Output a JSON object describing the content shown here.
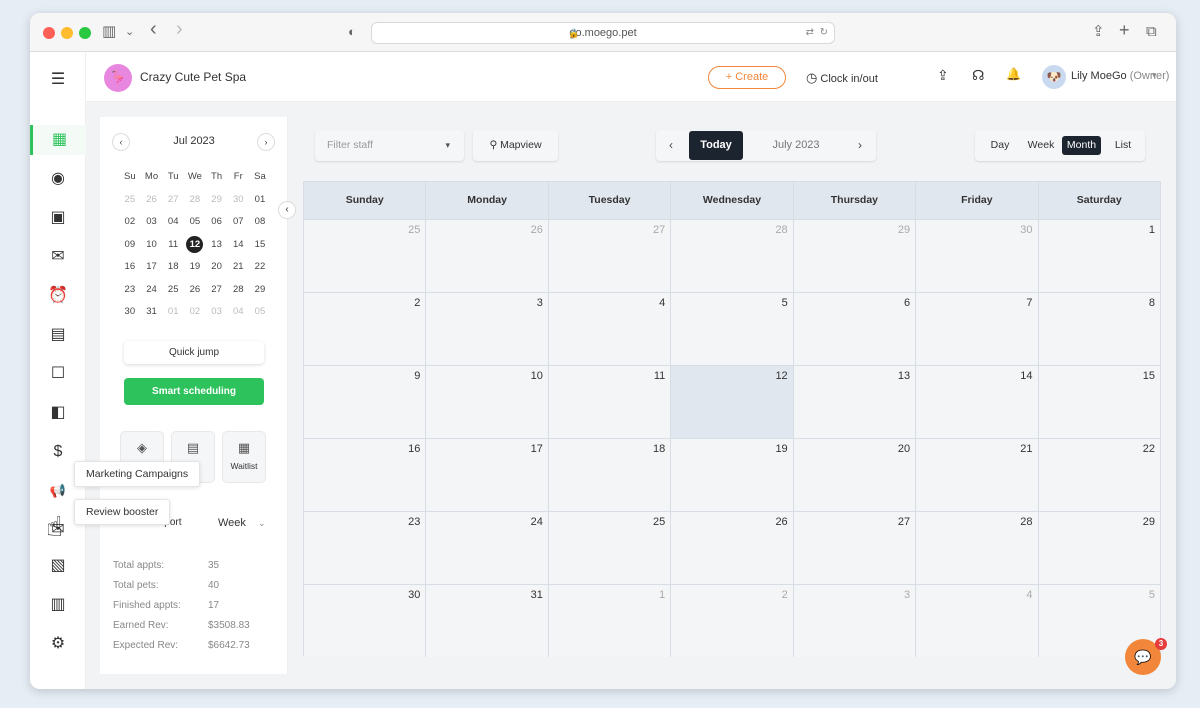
{
  "browser": {
    "url": "go.moego.pet",
    "icons": {
      "sidebar": "▥",
      "dropdown": "⌄",
      "back": "‹",
      "forward": "›",
      "shield": "◐",
      "lock": "🔒",
      "translate": "⇄",
      "reload": "↻",
      "share": "⇪",
      "newtab": "+",
      "tabs": "⧉"
    }
  },
  "leftnav": {
    "icons": [
      "☰",
      "▦",
      "◉",
      "▣",
      "✉",
      "⏰",
      "▤",
      "☐",
      "◧",
      "$",
      "📢",
      "✉",
      "▧",
      "▥",
      "⚙"
    ]
  },
  "header": {
    "business_name": "Crazy Cute Pet Spa",
    "logo_glyph": "🦩",
    "create_label": "+ Create",
    "clock_label": "Clock in/out",
    "clock_icon": "◷",
    "icons": {
      "upload": "⇪",
      "headset": "☊",
      "bell": "🔔"
    },
    "avatar_glyph": "🐶",
    "user_name": "Lily MoeGo",
    "user_role": "(Owner)",
    "caret": "▾"
  },
  "mini_calendar": {
    "title": "Jul 2023",
    "prev": "‹",
    "next": "›",
    "weekdays": [
      "Su",
      "Mo",
      "Tu",
      "We",
      "Th",
      "Fr",
      "Sa"
    ],
    "weeks": [
      [
        [
          "25",
          "m"
        ],
        [
          "26",
          "m"
        ],
        [
          "27",
          "m"
        ],
        [
          "28",
          "m"
        ],
        [
          "29",
          "m"
        ],
        [
          "30",
          "m"
        ],
        [
          "01",
          ""
        ]
      ],
      [
        [
          "02",
          ""
        ],
        [
          "03",
          ""
        ],
        [
          "04",
          ""
        ],
        [
          "05",
          ""
        ],
        [
          "06",
          ""
        ],
        [
          "07",
          ""
        ],
        [
          "08",
          ""
        ]
      ],
      [
        [
          "09",
          ""
        ],
        [
          "10",
          ""
        ],
        [
          "11",
          ""
        ],
        [
          "12",
          "t"
        ],
        [
          "13",
          ""
        ],
        [
          "14",
          ""
        ],
        [
          "15",
          ""
        ]
      ],
      [
        [
          "16",
          ""
        ],
        [
          "17",
          ""
        ],
        [
          "18",
          ""
        ],
        [
          "19",
          ""
        ],
        [
          "20",
          ""
        ],
        [
          "21",
          ""
        ],
        [
          "22",
          ""
        ]
      ],
      [
        [
          "23",
          ""
        ],
        [
          "24",
          ""
        ],
        [
          "25",
          ""
        ],
        [
          "26",
          ""
        ],
        [
          "27",
          ""
        ],
        [
          "28",
          ""
        ],
        [
          "29",
          ""
        ]
      ],
      [
        [
          "30",
          ""
        ],
        [
          "31",
          ""
        ],
        [
          "01",
          "m"
        ],
        [
          "02",
          "m"
        ],
        [
          "03",
          "m"
        ],
        [
          "04",
          "m"
        ],
        [
          "05",
          "m"
        ]
      ]
    ],
    "collapse": "‹"
  },
  "sidepanel": {
    "quick_jump": "Quick jump",
    "smart_scheduling": "Smart scheduling",
    "tiles": [
      {
        "icon": "◈",
        "label": ""
      },
      {
        "icon": "▤",
        "label": ""
      },
      {
        "icon": "▦",
        "label": "Waitlist"
      }
    ],
    "report_title": "Calendar report",
    "report_period": "Week",
    "report_caret": "⌄",
    "stats": [
      {
        "label": "Total appts:",
        "value": "35"
      },
      {
        "label": "Total pets:",
        "value": "40"
      },
      {
        "label": "Finished appts:",
        "value": "17"
      },
      {
        "label": "Earned Rev:",
        "value": "$3508.83"
      },
      {
        "label": "Expected Rev:",
        "value": "$6642.73"
      }
    ]
  },
  "tooltips": {
    "marketing": "Marketing Campaigns",
    "review": "Review booster"
  },
  "cursor": "☝",
  "toolbar": {
    "filter_placeholder": "Filter staff",
    "filter_caret": "▾",
    "mapview_label": "Mapview",
    "mapview_icon": "⚲",
    "prev": "‹",
    "next": "›",
    "today_label": "Today",
    "month_label": "July 2023",
    "views": [
      "Day",
      "Week",
      "Month",
      "List"
    ],
    "active_view": "Month"
  },
  "calendar": {
    "weekdays": [
      "Sunday",
      "Monday",
      "Tuesday",
      "Wednesday",
      "Thursday",
      "Friday",
      "Saturday"
    ],
    "weeks": [
      [
        [
          "25",
          "m"
        ],
        [
          "26",
          "m"
        ],
        [
          "27",
          "m"
        ],
        [
          "28",
          "m"
        ],
        [
          "29",
          "m"
        ],
        [
          "30",
          "m"
        ],
        [
          "1",
          ""
        ]
      ],
      [
        [
          "2",
          ""
        ],
        [
          "3",
          ""
        ],
        [
          "4",
          ""
        ],
        [
          "5",
          ""
        ],
        [
          "6",
          ""
        ],
        [
          "7",
          ""
        ],
        [
          "8",
          ""
        ]
      ],
      [
        [
          "9",
          ""
        ],
        [
          "10",
          ""
        ],
        [
          "11",
          ""
        ],
        [
          "12",
          "t"
        ],
        [
          "13",
          ""
        ],
        [
          "14",
          ""
        ],
        [
          "15",
          ""
        ]
      ],
      [
        [
          "16",
          ""
        ],
        [
          "17",
          ""
        ],
        [
          "18",
          ""
        ],
        [
          "19",
          ""
        ],
        [
          "20",
          ""
        ],
        [
          "21",
          ""
        ],
        [
          "22",
          ""
        ]
      ],
      [
        [
          "23",
          ""
        ],
        [
          "24",
          ""
        ],
        [
          "25",
          ""
        ],
        [
          "26",
          ""
        ],
        [
          "27",
          ""
        ],
        [
          "28",
          ""
        ],
        [
          "29",
          ""
        ]
      ],
      [
        [
          "30",
          ""
        ],
        [
          "31",
          ""
        ],
        [
          "1",
          "m"
        ],
        [
          "2",
          "m"
        ],
        [
          "3",
          "m"
        ],
        [
          "4",
          "m"
        ],
        [
          "5",
          "m"
        ]
      ]
    ]
  },
  "chat": {
    "icon": "💬",
    "badge": "3"
  }
}
